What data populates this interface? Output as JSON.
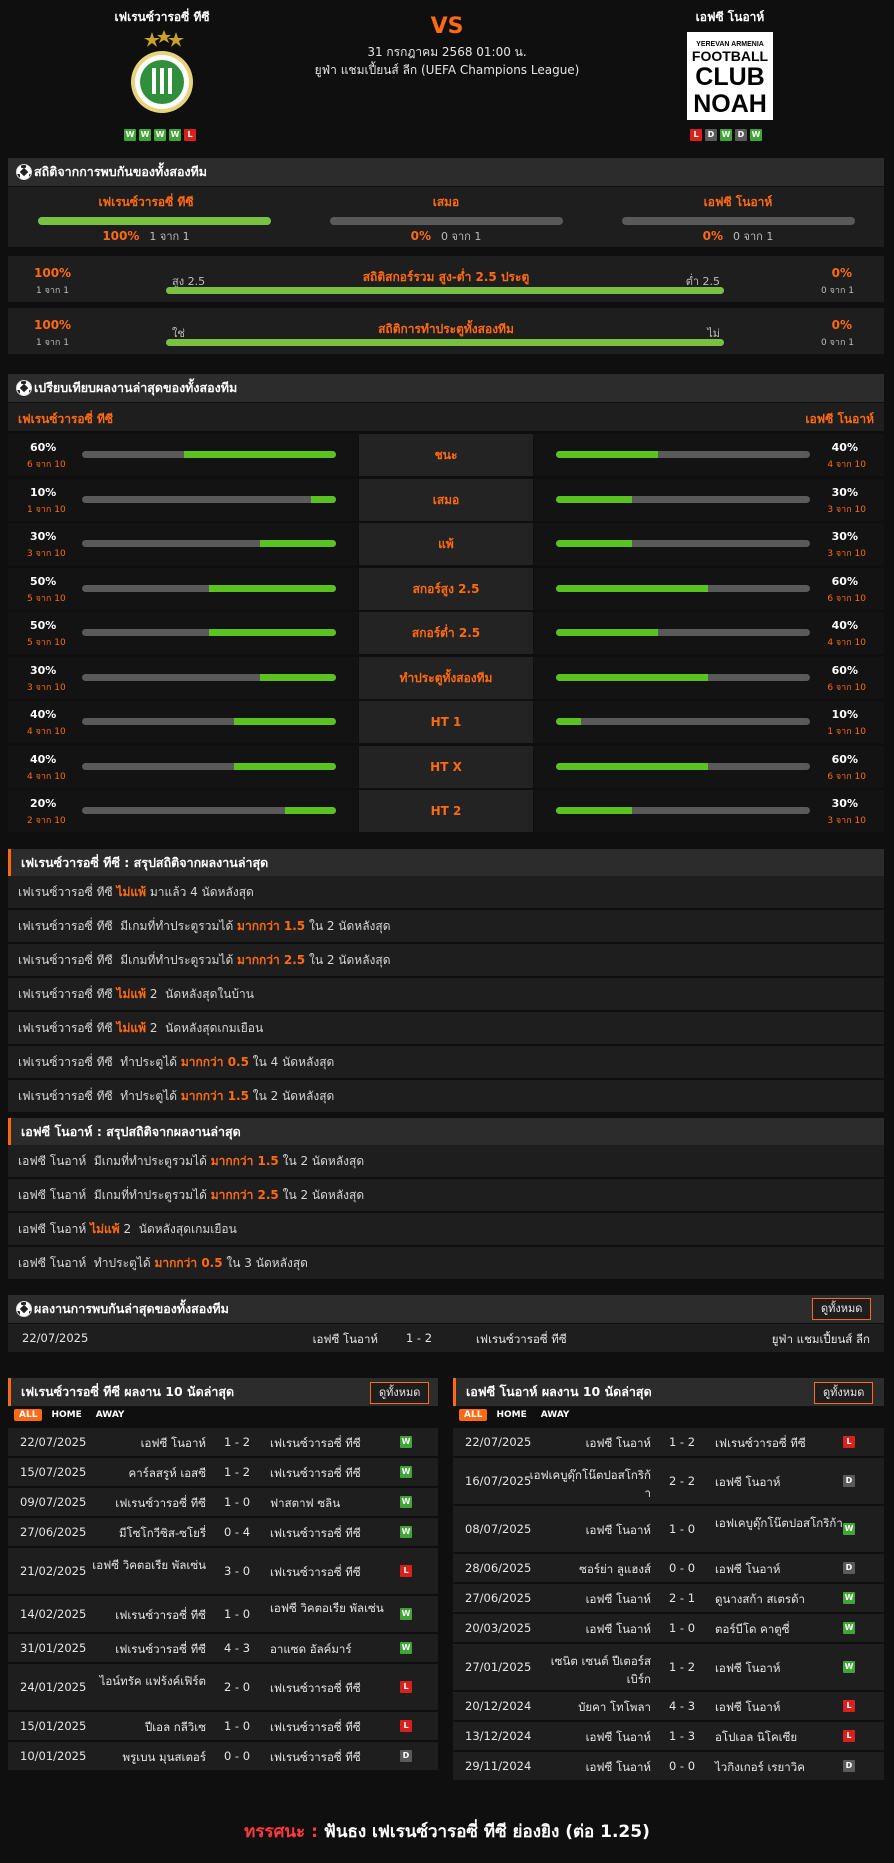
{
  "header": {
    "home_team": "เฟเรนซ์วารอซี่ ทีซี",
    "away_team": "เอฟซี โนอาห์",
    "vs": "VS",
    "date": "31 กรกฎาคม 2568 01:00 น.",
    "league": "ยูฟ่า แชมเปี้ยนส์ ลีก (UEFA Champions League)",
    "home_form": [
      "W",
      "W",
      "W",
      "W",
      "L"
    ],
    "away_form": [
      "L",
      "D",
      "W",
      "D",
      "W"
    ],
    "away_logo_lines": [
      "YEREVAN ARMENIA",
      "FOOTBALL",
      "CLUB",
      "NOAH"
    ],
    "home_logo_text": "FERENCVÁROSI TORNA CLUB 1899",
    "home_logo_color": "#2f8f3a"
  },
  "h2h_stats": {
    "title": "สถิติจากการพบกันของทั้งสองทีม",
    "home": {
      "label": "เฟเรนซ์วารอซี่ ทีซี",
      "pct": "100%",
      "sub": "1 จาก 1",
      "value": 1.0
    },
    "draw": {
      "label": "เสมอ",
      "pct": "0%",
      "sub": "0 จาก 1",
      "value": 0.0
    },
    "away": {
      "label": "เอฟซี โนอาห์",
      "pct": "0%",
      "sub": "0 จาก 1",
      "value": 0.0
    },
    "over_under": {
      "title": "สถิติสกอร์รวม สูง-ต่ำ 2.5 ประตู",
      "left_tag": "สูง 2.5",
      "right_tag": "ต่ำ 2.5",
      "left_pct": "100%",
      "left_sub": "1 จาก 1",
      "right_pct": "0%",
      "right_sub": "0 จาก 1",
      "value": 1.0
    },
    "btts": {
      "title": "สถิติการทำประตูทั้งสองทีม",
      "left_tag": "ใช่",
      "right_tag": "ไม่",
      "left_pct": "100%",
      "left_sub": "1 จาก 1",
      "right_pct": "0%",
      "right_sub": "0 จาก 1",
      "value": 1.0
    }
  },
  "compare": {
    "title": "เปรียบเทียบผลงานล่าสุดของทั้งสองทีม",
    "home_label": "เฟเรนซ์วารอซี่ ทีซี",
    "away_label": "เอฟซี โนอาห์",
    "rows": [
      {
        "label": "ชนะ",
        "home_pct": "60%",
        "home_sub": "6 จาก 10",
        "home_val": 0.6,
        "away_pct": "40%",
        "away_sub": "4 จาก 10",
        "away_val": 0.4
      },
      {
        "label": "เสมอ",
        "home_pct": "10%",
        "home_sub": "1 จาก 10",
        "home_val": 0.1,
        "away_pct": "30%",
        "away_sub": "3 จาก 10",
        "away_val": 0.3
      },
      {
        "label": "แพ้",
        "home_pct": "30%",
        "home_sub": "3 จาก 10",
        "home_val": 0.3,
        "away_pct": "30%",
        "away_sub": "3 จาก 10",
        "away_val": 0.3
      },
      {
        "label": "สกอร์สูง 2.5",
        "home_pct": "50%",
        "home_sub": "5 จาก 10",
        "home_val": 0.5,
        "away_pct": "60%",
        "away_sub": "6 จาก 10",
        "away_val": 0.6
      },
      {
        "label": "สกอร์ต่ำ 2.5",
        "home_pct": "50%",
        "home_sub": "5 จาก 10",
        "home_val": 0.5,
        "away_pct": "40%",
        "away_sub": "4 จาก 10",
        "away_val": 0.4
      },
      {
        "label": "ทำประตูทั้งสองทีม",
        "home_pct": "30%",
        "home_sub": "3 จาก 10",
        "home_val": 0.3,
        "away_pct": "60%",
        "away_sub": "6 จาก 10",
        "away_val": 0.6
      },
      {
        "label": "HT 1",
        "home_pct": "40%",
        "home_sub": "4 จาก 10",
        "home_val": 0.4,
        "away_pct": "10%",
        "away_sub": "1 จาก 10",
        "away_val": 0.1
      },
      {
        "label": "HT X",
        "home_pct": "40%",
        "home_sub": "4 จาก 10",
        "home_val": 0.4,
        "away_pct": "60%",
        "away_sub": "6 จาก 10",
        "away_val": 0.6
      },
      {
        "label": "HT 2",
        "home_pct": "20%",
        "home_sub": "2 จาก 10",
        "home_val": 0.2,
        "away_pct": "30%",
        "away_sub": "3 จาก 10",
        "away_val": 0.3
      }
    ]
  },
  "home_summary": {
    "title": "เฟเรนซ์วารอซี่ ทีซี : สรุปสถิติจากผลงานล่าสุด",
    "rows": [
      {
        "pre": "เฟเรนซ์วารอซี่ ทีซี ",
        "hl": "ไม่แพ้",
        "post": " มาแล้ว 4 นัดหลังสุด"
      },
      {
        "pre": "เฟเรนซ์วารอซี่ ทีซี  มีเกมที่ทำประตูรวมได้ ",
        "hl": "มากกว่า 1.5",
        "post": " ใน 2 นัดหลังสุด"
      },
      {
        "pre": "เฟเรนซ์วารอซี่ ทีซี  มีเกมที่ทำประตูรวมได้ ",
        "hl": "มากกว่า 2.5",
        "post": " ใน 2 นัดหลังสุด"
      },
      {
        "pre": "เฟเรนซ์วารอซี่ ทีซี ",
        "hl": "ไม่แพ้",
        "post": " 2  นัดหลังสุดในบ้าน"
      },
      {
        "pre": "เฟเรนซ์วารอซี่ ทีซี ",
        "hl": "ไม่แพ้",
        "post": " 2  นัดหลังสุดเกมเยือน"
      },
      {
        "pre": "เฟเรนซ์วารอซี่ ทีซี  ทำประตูได้ ",
        "hl": "มากกว่า 0.5",
        "post": " ใน 4 นัดหลังสุด"
      },
      {
        "pre": "เฟเรนซ์วารอซี่ ทีซี  ทำประตูได้ ",
        "hl": "มากกว่า 1.5",
        "post": " ใน 2 นัดหลังสุด"
      }
    ]
  },
  "away_summary": {
    "title": "เอฟซี โนอาห์ : สรุปสถิติจากผลงานล่าสุด",
    "rows": [
      {
        "pre": "เอฟซี โนอาห์  มีเกมที่ทำประตูรวมได้ ",
        "hl": "มากกว่า 1.5",
        "post": " ใน 2 นัดหลังสุด"
      },
      {
        "pre": "เอฟซี โนอาห์  มีเกมที่ทำประตูรวมได้ ",
        "hl": "มากกว่า 2.5",
        "post": " ใน 2 นัดหลังสุด"
      },
      {
        "pre": "เอฟซี โนอาห์ ",
        "hl": "ไม่แพ้",
        "post": " 2  นัดหลังสุดเกมเยือน"
      },
      {
        "pre": "เอฟซี โนอาห์  ทำประตูได้ ",
        "hl": "มากกว่า 0.5",
        "post": " ใน 3 นัดหลังสุด"
      }
    ]
  },
  "h2h_results": {
    "title": "ผลงานการพบกันล่าสุดของทั้งสองทีม",
    "view_all": "ดูทั้งหมด",
    "rows": [
      {
        "date": "22/07/2025",
        "home": "เอฟซี โนอาห์",
        "score": "1 - 2",
        "away": "เฟเรนซ์วารอซี่ ทีซี",
        "league": "ยูฟ่า แชมเปี้ยนส์ ลีก"
      }
    ]
  },
  "home_recent": {
    "title": "เฟเรนซ์วารอซี่ ทีซี ผลงาน 10 นัดล่าสุด",
    "view_all": "ดูทั้งหมด",
    "filters": [
      "ALL",
      "HOME",
      "AWAY"
    ],
    "rows": [
      {
        "date": "22/07/2025",
        "home": "เอฟซี โนอาห์",
        "score": "1 - 2",
        "away": "เฟเรนซ์วารอซี่ ทีซี",
        "res": "W"
      },
      {
        "date": "15/07/2025",
        "home": "คาร์ลสรูห์ เอสซี",
        "score": "1 - 2",
        "away": "เฟเรนซ์วารอซี่ ทีซี",
        "res": "W"
      },
      {
        "date": "09/07/2025",
        "home": "เฟเรนซ์วารอซี่ ทีซี",
        "score": "1 - 0",
        "away": "ฟาสตาฟ ซลิน",
        "res": "W"
      },
      {
        "date": "27/06/2025",
        "home": "มีโซโกวีซิส-ซโยรี่",
        "score": "0 - 4",
        "away": "เฟเรนซ์วารอซี่ ทีซี",
        "res": "W"
      },
      {
        "date": "21/02/2025",
        "home": "เอฟซี วิคตอเรีย พัลเซ่น",
        "score": "3 - 0",
        "away": "เฟเรนซ์วารอซี่ ทีซี",
        "res": "L"
      },
      {
        "date": "14/02/2025",
        "home": "เฟเรนซ์วารอซี่ ทีซี",
        "score": "1 - 0",
        "away": "เอฟซี วิคตอเรีย พัลเซ่น",
        "res": "W"
      },
      {
        "date": "31/01/2025",
        "home": "เฟเรนซ์วารอซี่ ทีซี",
        "score": "4 - 3",
        "away": "อาแซด อัลค์มาร์",
        "res": "W"
      },
      {
        "date": "24/01/2025",
        "home": "ไอน์ทรัค แฟร้งค์เฟิร์ต",
        "score": "2 - 0",
        "away": "เฟเรนซ์วารอซี่ ทีซี",
        "res": "L"
      },
      {
        "date": "15/01/2025",
        "home": "ปีเอล กลีวิเซ",
        "score": "1 - 0",
        "away": "เฟเรนซ์วารอซี่ ทีซี",
        "res": "L"
      },
      {
        "date": "10/01/2025",
        "home": "พรูเบน มุนสเตอร์",
        "score": "0 - 0",
        "away": "เฟเรนซ์วารอซี่ ทีซี",
        "res": "D"
      }
    ]
  },
  "away_recent": {
    "title": "เอฟซี โนอาห์ ผลงาน 10 นัดล่าสุด",
    "view_all": "ดูทั้งหมด",
    "filters": [
      "ALL",
      "HOME",
      "AWAY"
    ],
    "rows": [
      {
        "date": "22/07/2025",
        "home": "เอฟซี โนอาห์",
        "score": "1 - 2",
        "away": "เฟเรนซ์วารอซี่ ทีซี",
        "res": "L"
      },
      {
        "date": "16/07/2025",
        "home": "เอฟเคบูดุ๊กโน๊ตปอสโกริก้า",
        "score": "2 - 2",
        "away": "เอฟซี โนอาห์",
        "res": "D"
      },
      {
        "date": "08/07/2025",
        "home": "เอฟซี โนอาห์",
        "score": "1 - 0",
        "away": "เอฟเคบูดุ๊กโน๊ตปอสโกริก้า",
        "res": "W"
      },
      {
        "date": "28/06/2025",
        "home": "ซอร์ย่า ลูแฮงส์",
        "score": "0 - 0",
        "away": "เอฟซี โนอาห์",
        "res": "D"
      },
      {
        "date": "27/06/2025",
        "home": "เอฟซี โนอาห์",
        "score": "2 - 1",
        "away": "ดูนางสก้า สเตรด้า",
        "res": "W"
      },
      {
        "date": "20/03/2025",
        "home": "เอฟซี โนอาห์",
        "score": "1 - 0",
        "away": "ตอร์บีโด คาตูซี่",
        "res": "W"
      },
      {
        "date": "27/01/2025",
        "home": "เซนิต เซนต์ ปีเตอร์สเบิร์ก",
        "score": "1 - 2",
        "away": "เอฟซี โนอาห์",
        "res": "W"
      },
      {
        "date": "20/12/2024",
        "home": "บัยคา โทโพลา",
        "score": "4 - 3",
        "away": "เอฟซี โนอาห์",
        "res": "L"
      },
      {
        "date": "13/12/2024",
        "home": "เอฟซี โนอาห์",
        "score": "1 - 3",
        "away": "อโปเอล นิโคเซีย",
        "res": "L"
      },
      {
        "date": "29/11/2024",
        "home": "เอฟซี โนอาห์",
        "score": "0 - 0",
        "away": "ไวกิงเกอร์ เรยาวิค",
        "res": "D"
      }
    ]
  },
  "verdict": {
    "label": "ทรรศนะ :",
    "text": "ฟันธง เฟเรนซ์วารอซี่ ทีซี ย่องยิง (ต่อ 1.25)"
  },
  "colors": {
    "accent": "#ff6a13",
    "win": "#3fa535",
    "loss": "#d8201d",
    "draw": "#5a5a5a",
    "bar": "#5ac31f"
  }
}
